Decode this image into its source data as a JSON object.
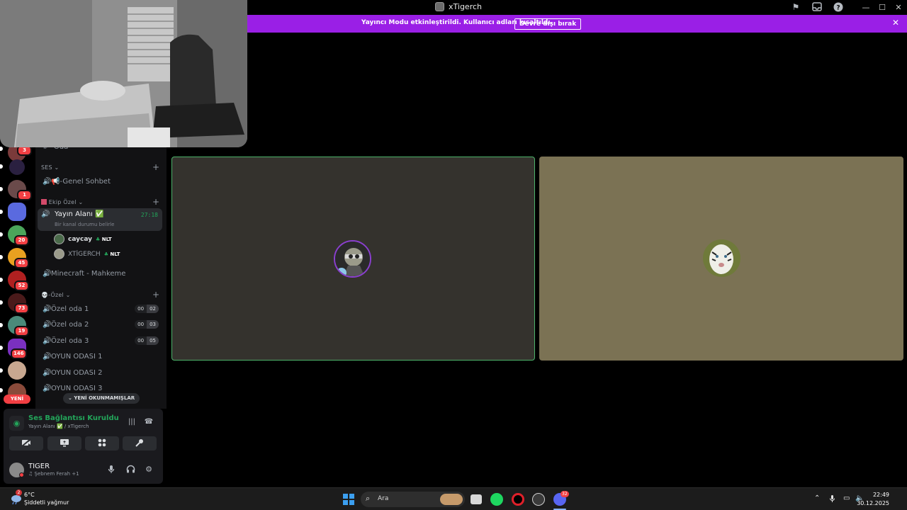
{
  "window": {
    "title": "xTigerch"
  },
  "banner": {
    "message": "Yayıncı Modu etkinleştirildi. Kullanıcı adları kısaltıldı.",
    "button": "Devre dışı bırak"
  },
  "servers": {
    "badges": [
      "3",
      "1",
      "20",
      "45",
      "52",
      "73",
      "19",
      "146"
    ],
    "new_label": "YENİ"
  },
  "sidebar": {
    "partial_channel": "-Oda",
    "categories": {
      "ses": "SES",
      "ekip": "Ekip Özel",
      "ozel": "-Özel"
    },
    "channels": {
      "genel_sohbet": "📢-Genel Sohbet",
      "yayin_alani": "Yayın Alanı ✅",
      "yayin_timer": "27:18",
      "yayin_status": "Bir kanal durumu belirle",
      "minecraft": "Minecraft - Mahkeme",
      "ozel_oda_1": "Özel oda 1",
      "ozel_oda_2": "Özel oda 2",
      "ozel_oda_3": "Özel oda 3",
      "oyun_1": "OYUN ODASI 1",
      "oyun_2": "OYUN ODASI 2",
      "oyun_3": "OYUN ODASI 3"
    },
    "room_counts": [
      {
        "users": "00",
        "limit": "02"
      },
      {
        "users": "00",
        "limit": "03"
      },
      {
        "users": "00",
        "limit": "05"
      }
    ],
    "voice_users": [
      {
        "name": "caycay",
        "tag": "NLT"
      },
      {
        "name": "XTİGERCH",
        "tag": "NLT"
      }
    ],
    "unread_pill": "YENİ OKUNMAMIŞLAR"
  },
  "voice_panel": {
    "status": "Ses Bağlantısı Kuruldu",
    "location": "Yayın Alanı ✅ / xTigerch",
    "username": "TIGER",
    "activity": "♫ Şebnem Ferah +1"
  },
  "taskbar": {
    "temperature": "6°C",
    "weather": "Şiddetli yağmur",
    "weather_badge": "2",
    "search_placeholder": "Ara",
    "discord_badge": "32",
    "time": "22:49",
    "date": "30.12.2025"
  },
  "colors": {
    "banner": "#9a1fe6",
    "connected": "#23a55a",
    "badge": "#f23f43",
    "tile_speaking_border": "#4cb36a"
  }
}
